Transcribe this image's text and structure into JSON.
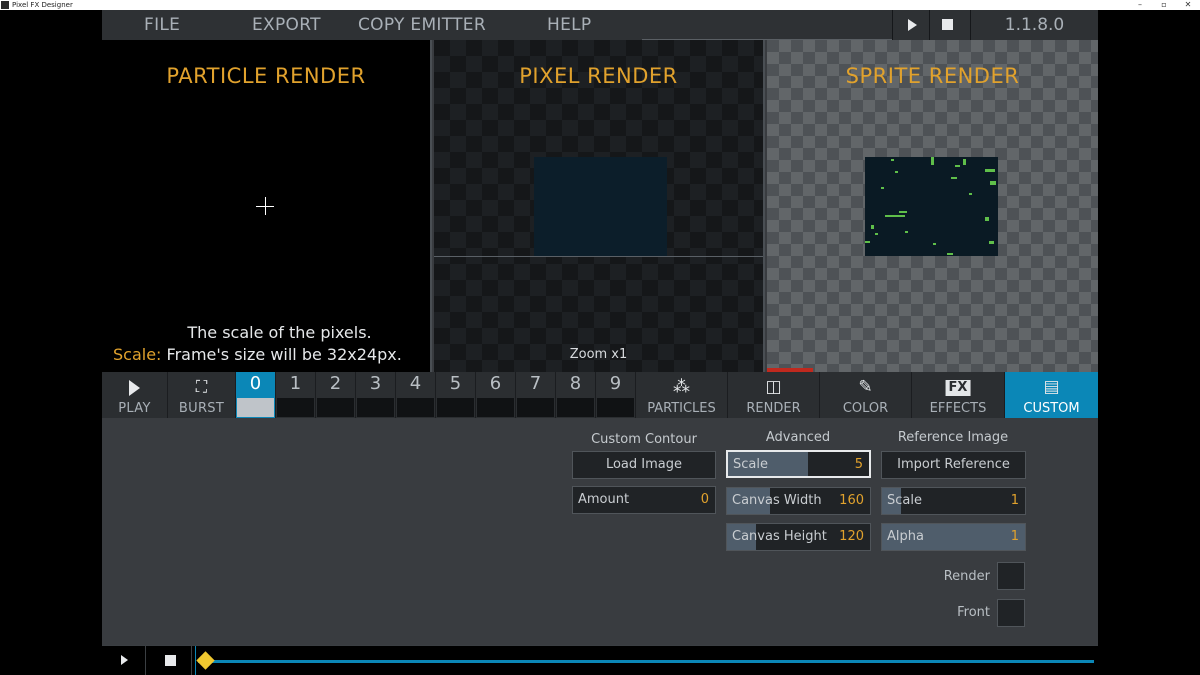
{
  "window": {
    "title": "Pixel FX Designer",
    "controls": [
      "–",
      "▫",
      "✕"
    ]
  },
  "menu": {
    "file": "FILE",
    "export": "EXPORT",
    "copy_emitter": "COPY EMITTER",
    "help": "HELP",
    "version": "1.1.8.0"
  },
  "panels": {
    "particle": {
      "title": "PARTICLE RENDER"
    },
    "pixel": {
      "title": "PIXEL RENDER",
      "zoom": "Zoom x1"
    },
    "sprite": {
      "title": "SPRITE RENDER"
    }
  },
  "tooltip": {
    "line1": "The scale of the pixels.",
    "label": "Scale:",
    "line2": "Frame's size will be 32x24px."
  },
  "toolbar": {
    "play": "PLAY",
    "burst": "BURST"
  },
  "emitters": {
    "numbers": [
      "0",
      "1",
      "2",
      "3",
      "4",
      "5",
      "6",
      "7",
      "8",
      "9"
    ],
    "active": "0"
  },
  "tabs": {
    "particles": "PARTICLES",
    "render": "RENDER",
    "color": "COLOR",
    "effects": "EFFECTS",
    "fx_badge": "FX",
    "custom": "CUSTOM"
  },
  "custom_contour": {
    "title": "Custom Contour",
    "load_image": "Load Image",
    "amount": {
      "label": "Amount",
      "value": "0",
      "fill": 0
    }
  },
  "advanced": {
    "title": "Advanced",
    "scale": {
      "label": "Scale",
      "value": "5",
      "fill": 0.57
    },
    "canvas_width": {
      "label": "Canvas Width",
      "value": "160",
      "fill": 0.3
    },
    "canvas_height": {
      "label": "Canvas Height",
      "value": "120",
      "fill": 0.2
    }
  },
  "reference_image": {
    "title": "Reference Image",
    "import": "Import Reference",
    "scale": {
      "label": "Scale",
      "value": "1",
      "fill": 0.13
    },
    "alpha": {
      "label": "Alpha",
      "value": "1",
      "fill": 1.0
    },
    "render_label": "Render",
    "front_label": "Front"
  },
  "colors": {
    "accent": "#0b87b7",
    "value": "#e1a22d",
    "knob": "#f0c830"
  }
}
